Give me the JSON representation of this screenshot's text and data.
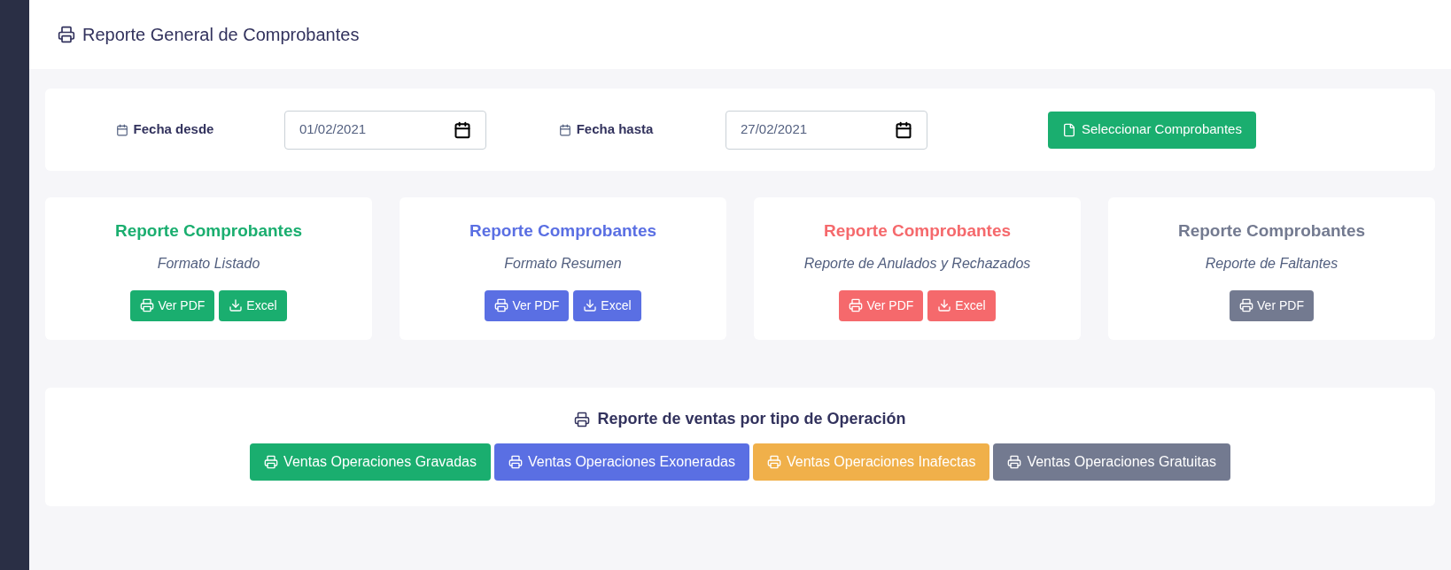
{
  "header": {
    "title": "Reporte General de Comprobantes"
  },
  "filters": {
    "date_from": {
      "label": "Fecha desde",
      "value": "01/02/2021"
    },
    "date_to": {
      "label": "Fecha hasta",
      "value": "27/02/2021"
    },
    "button": "Seleccionar Comprobantes"
  },
  "report_cards": [
    {
      "title": "Reporte Comprobantes",
      "subtitle": "Formato Listado",
      "color": "#1aae6f",
      "buttons": [
        {
          "kind": "pdf",
          "label": "Ver PDF"
        },
        {
          "kind": "excel",
          "label": "Excel"
        }
      ]
    },
    {
      "title": "Reporte Comprobantes",
      "subtitle": "Formato Resumen",
      "color": "#5a6fe3",
      "buttons": [
        {
          "kind": "pdf",
          "label": "Ver PDF"
        },
        {
          "kind": "excel",
          "label": "Excel"
        }
      ]
    },
    {
      "title": "Reporte Comprobantes",
      "subtitle": "Reporte de Anulados y Rechazados",
      "color": "#f5696c",
      "buttons": [
        {
          "kind": "pdf",
          "label": "Ver PDF"
        },
        {
          "kind": "excel",
          "label": "Excel"
        }
      ]
    },
    {
      "title": "Reporte Comprobantes",
      "subtitle": "Reporte de Faltantes",
      "color": "#737a90",
      "buttons": [
        {
          "kind": "pdf",
          "label": "Ver PDF"
        }
      ]
    }
  ],
  "operations": {
    "title": "Reporte de ventas por tipo de Operación",
    "buttons": [
      {
        "label": "Ventas Operaciones Gravadas",
        "color": "#1aae6f"
      },
      {
        "label": "Ventas Operaciones Exoneradas",
        "color": "#5a6fe3"
      },
      {
        "label": "Ventas Operaciones Inafectas",
        "color": "#f0b04a"
      },
      {
        "label": "Ventas Operaciones Gratuitas",
        "color": "#737a90"
      }
    ]
  }
}
